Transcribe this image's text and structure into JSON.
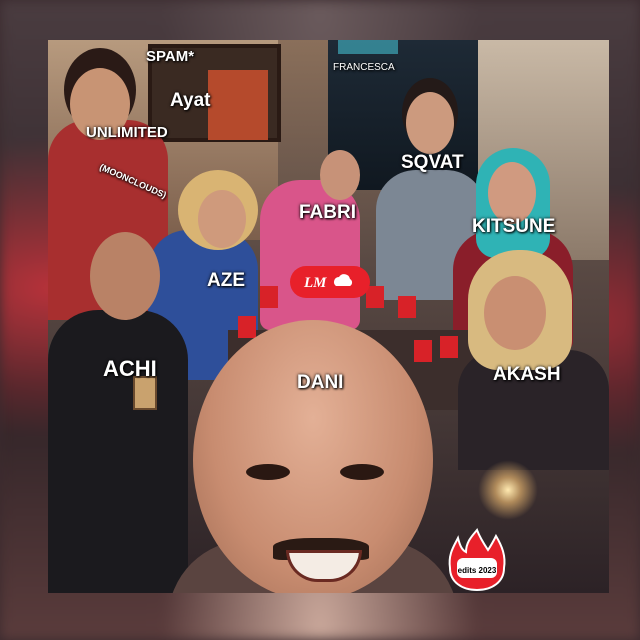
{
  "labels": {
    "spam": "SPAM*",
    "francesca": "FRANCESCA",
    "ayat": "Ayat",
    "unlimited": "UNLIMITED",
    "moonclouds": "(MOONCLOUDS)",
    "sqvat": "SQVAT",
    "fabri": "FABRI",
    "kitsune": "KITSUNE",
    "aze": "AZE",
    "achi": "ACHI",
    "dani": "DANI",
    "akash": "AKASH"
  },
  "logo": {
    "text": "LM"
  },
  "badge": {
    "text": "edits 2023"
  },
  "colors": {
    "accent_red": "#e8202a",
    "label": "#ffffff"
  }
}
